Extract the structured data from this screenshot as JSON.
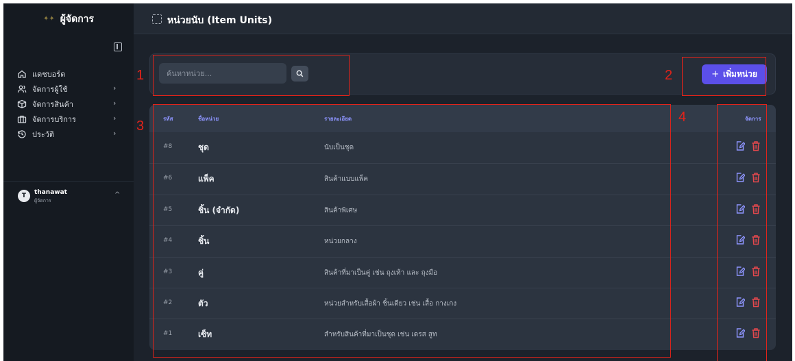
{
  "sidebar": {
    "brand_logo": "✦✦",
    "brand_title": "ผู้จัดการ",
    "items": [
      {
        "label": "แดชบอร์ด",
        "icon": "home-icon",
        "has_chevron": false
      },
      {
        "label": "จัดการผู้ใช้",
        "icon": "users-icon",
        "has_chevron": true
      },
      {
        "label": "จัดการสินค้า",
        "icon": "box-icon",
        "has_chevron": true
      },
      {
        "label": "จัดการบริการ",
        "icon": "briefcase-icon",
        "has_chevron": true
      },
      {
        "label": "ประวัติ",
        "icon": "history-icon",
        "has_chevron": true
      }
    ],
    "chevron": "›",
    "user": {
      "initial": "T",
      "name": "thanawat",
      "role": "ผู้จัดการ",
      "chevron": "^"
    }
  },
  "header": {
    "title": "หน่วยนับ (Item Units)"
  },
  "toolbar": {
    "search_placeholder": "ค้นหาหน่วย...",
    "search_value": "",
    "add_plus": "+",
    "add_label": "เพิ่มหน่วย"
  },
  "table": {
    "columns": {
      "id": "รหัส",
      "name": "ชื่อหน่วย",
      "desc": "รายละเอียด",
      "actions": "จัดการ"
    },
    "rows": [
      {
        "id": "#8",
        "name": "ชุด",
        "desc": "นับเป็นชุด"
      },
      {
        "id": "#6",
        "name": "แพ็ค",
        "desc": "สินค้าแบบแพ็ค"
      },
      {
        "id": "#5",
        "name": "ชิ้น (จำกัด)",
        "desc": "สินค้าพิเศษ"
      },
      {
        "id": "#4",
        "name": "ชิ้น",
        "desc": "หน่วยกลาง"
      },
      {
        "id": "#3",
        "name": "คู่",
        "desc": "สินค้าที่มาเป็นคู่ เช่น ถุงเท้า และ ถุงมือ"
      },
      {
        "id": "#2",
        "name": "ตัว",
        "desc": "หน่วยสำหรับเสื้อผ้า ชิ้นเดียว เช่น เสื้อ กางเกง"
      },
      {
        "id": "#1",
        "name": "เซ็ท",
        "desc": "สำหรับสินค้าที่มาเป็นชุด เช่น เดรส สูท"
      }
    ]
  },
  "annotations": [
    "1",
    "2",
    "3",
    "4"
  ],
  "colors": {
    "accent": "#5b4fe9",
    "edit": "#8e95ff",
    "delete": "#e5484d",
    "annotation": "#e2231a"
  }
}
